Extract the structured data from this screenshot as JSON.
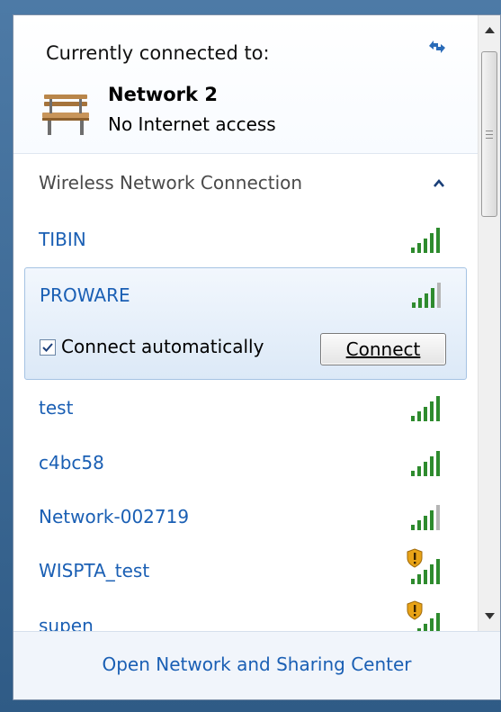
{
  "current_connection": {
    "label": "Currently connected to:",
    "network_name": "Network  2",
    "status": "No Internet access",
    "icons": [
      "refresh-icon",
      "bench-network-icon"
    ]
  },
  "wireless": {
    "section_title": "Wireless Network Connection",
    "networks": [
      {
        "name": "TIBIN",
        "signal_bars": 5,
        "secured_warning": false
      },
      {
        "name": "PROWARE",
        "signal_bars": 4,
        "secured_warning": false,
        "selected": true,
        "connect_auto_label": "Connect automatically",
        "connect_auto_checked": true,
        "connect_label": "Connect"
      },
      {
        "name": "test",
        "signal_bars": 5,
        "secured_warning": false
      },
      {
        "name": "c4bc58",
        "signal_bars": 5,
        "secured_warning": false
      },
      {
        "name": "Network-002719",
        "signal_bars": 4,
        "secured_warning": false
      },
      {
        "name": "WISPTA_test",
        "signal_bars": 5,
        "secured_warning": true
      },
      {
        "name": "supen",
        "signal_bars": 5,
        "secured_warning": true
      }
    ]
  },
  "footer": {
    "link_label": "Open Network and Sharing Center"
  },
  "colors": {
    "link": "#1a5fb4",
    "signal_green": "#2e8b2e",
    "signal_gray": "#b5b5b5"
  }
}
